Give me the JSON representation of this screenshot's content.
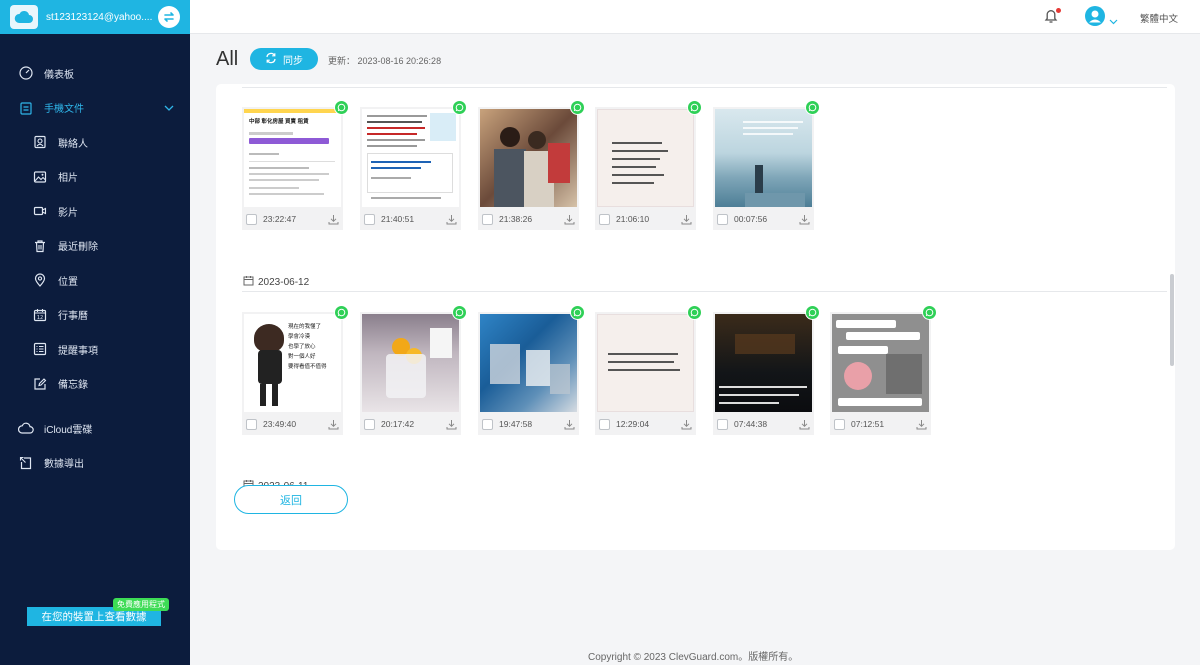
{
  "account": {
    "email": "st123123124@yahoo....",
    "logo_text": "iCloud"
  },
  "sidebar": {
    "items": [
      {
        "label": "儀表板",
        "icon": "dashboard-icon"
      },
      {
        "label": "手機文件",
        "icon": "document-icon"
      },
      {
        "label": "聯絡人",
        "icon": "contacts-icon"
      },
      {
        "label": "相片",
        "icon": "photo-icon"
      },
      {
        "label": "影片",
        "icon": "video-icon"
      },
      {
        "label": "最近刪除",
        "icon": "trash-icon"
      },
      {
        "label": "位置",
        "icon": "location-icon"
      },
      {
        "label": "行事曆",
        "icon": "calendar-icon"
      },
      {
        "label": "提醒事項",
        "icon": "reminders-icon"
      },
      {
        "label": "備忘錄",
        "icon": "notes-icon"
      },
      {
        "label": "iCloud雲碟",
        "icon": "cloud-icon"
      },
      {
        "label": "數據導出",
        "icon": "export-icon"
      }
    ],
    "promo_tag": "免費應用程式",
    "promo_button": "在您的裝置上查看數據"
  },
  "topbar": {
    "language": "繁體中文"
  },
  "header": {
    "title": "All",
    "sync_label": "同步",
    "updated_label": "更新： 2023-08-16 20:26:28"
  },
  "groups": [
    {
      "date": "",
      "items": [
        {
          "time": "23:22:47"
        },
        {
          "time": "21:40:51"
        },
        {
          "time": "21:38:26"
        },
        {
          "time": "21:06:10"
        },
        {
          "time": "00:07:56"
        }
      ]
    },
    {
      "date": "2023-06-12",
      "items": [
        {
          "time": "23:49:40"
        },
        {
          "time": "20:17:42"
        },
        {
          "time": "19:47:58"
        },
        {
          "time": "12:29:04"
        },
        {
          "time": "07:44:38"
        },
        {
          "time": "07:12:51"
        }
      ]
    },
    {
      "date": "2023-06-11",
      "items": []
    }
  ],
  "thumb_text": {
    "doc1_title": "中部 彰化房屋 買賣 租賃",
    "drawing_lines": [
      "現在的我懂了",
      "學會冷漠",
      "也學了放心",
      "對一個人好",
      "要得看值不值得"
    ]
  },
  "back_button": "返回",
  "footer": {
    "copyright": "Copyright © 2023 ClevGuard.com。版權所有。"
  },
  "colors": {
    "accent": "#1fb5e2",
    "sidebar_bg": "#0c1c3d",
    "whatsapp": "#2fd057"
  }
}
